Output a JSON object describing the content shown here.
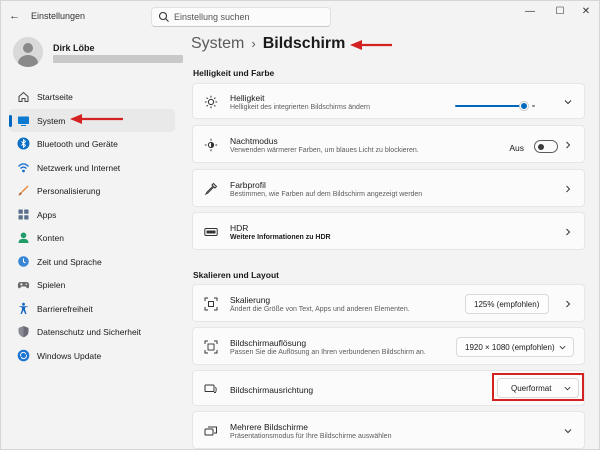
{
  "window": {
    "app_title": "Einstellungen",
    "search_placeholder": "Einstellung suchen",
    "controls": {
      "minimize": "—",
      "maximize": "☐",
      "close": "✕"
    }
  },
  "profile": {
    "name": "Dirk Löbe"
  },
  "sidebar": {
    "items": [
      {
        "label": "Startseite",
        "icon": "home-icon"
      },
      {
        "label": "System",
        "icon": "system-display-icon",
        "active": true
      },
      {
        "label": "Bluetooth und Geräte",
        "icon": "bluetooth-icon"
      },
      {
        "label": "Netzwerk und Internet",
        "icon": "network-icon"
      },
      {
        "label": "Personalisierung",
        "icon": "brush-icon"
      },
      {
        "label": "Apps",
        "icon": "apps-icon"
      },
      {
        "label": "Konten",
        "icon": "account-icon"
      },
      {
        "label": "Zeit und Sprache",
        "icon": "globe-clock-icon"
      },
      {
        "label": "Spielen",
        "icon": "gamepad-icon"
      },
      {
        "label": "Barrierefreiheit",
        "icon": "accessibility-icon"
      },
      {
        "label": "Datenschutz und Sicherheit",
        "icon": "shield-icon"
      },
      {
        "label": "Windows Update",
        "icon": "update-icon"
      }
    ]
  },
  "breadcrumb": {
    "parent": "System",
    "separator": "›",
    "current": "Bildschirm"
  },
  "sections": {
    "brightness_color": "Helligkeit und Farbe",
    "scale_layout": "Skalieren und Layout"
  },
  "cards": {
    "brightness": {
      "title": "Helligkeit",
      "subtitle": "Helligkeit des integrierten Bildschirms ändern",
      "level": 0.9
    },
    "night_mode": {
      "title": "Nachtmodus",
      "subtitle": "Verwenden wärmerer Farben, um blaues Licht zu blockieren.",
      "state_label": "Aus"
    },
    "color_profile": {
      "title": "Farbprofil",
      "subtitle": "Bestimmen, wie Farben auf dem Bildschirm angezeigt werden"
    },
    "hdr": {
      "title": "HDR",
      "subtitle": "Weitere Informationen zu HDR"
    },
    "scaling": {
      "title": "Skalierung",
      "subtitle": "Ändert die Größe von Text, Apps und anderen Elementen.",
      "value": "125% (empfohlen)"
    },
    "resolution": {
      "title": "Bildschirmauflösung",
      "subtitle": "Passen Sie die Auflösung an Ihren verbundenen Bildschirm an.",
      "value": "1920 × 1080 (empfohlen)"
    },
    "orientation": {
      "title": "Bildschirmausrichtung",
      "value": "Querformat"
    },
    "multi_display": {
      "title": "Mehrere Bildschirme",
      "subtitle": "Präsentationsmodus für Ihre Bildschirme auswählen"
    }
  },
  "colors": {
    "accent": "#0067c0",
    "annotation": "#d42222"
  }
}
